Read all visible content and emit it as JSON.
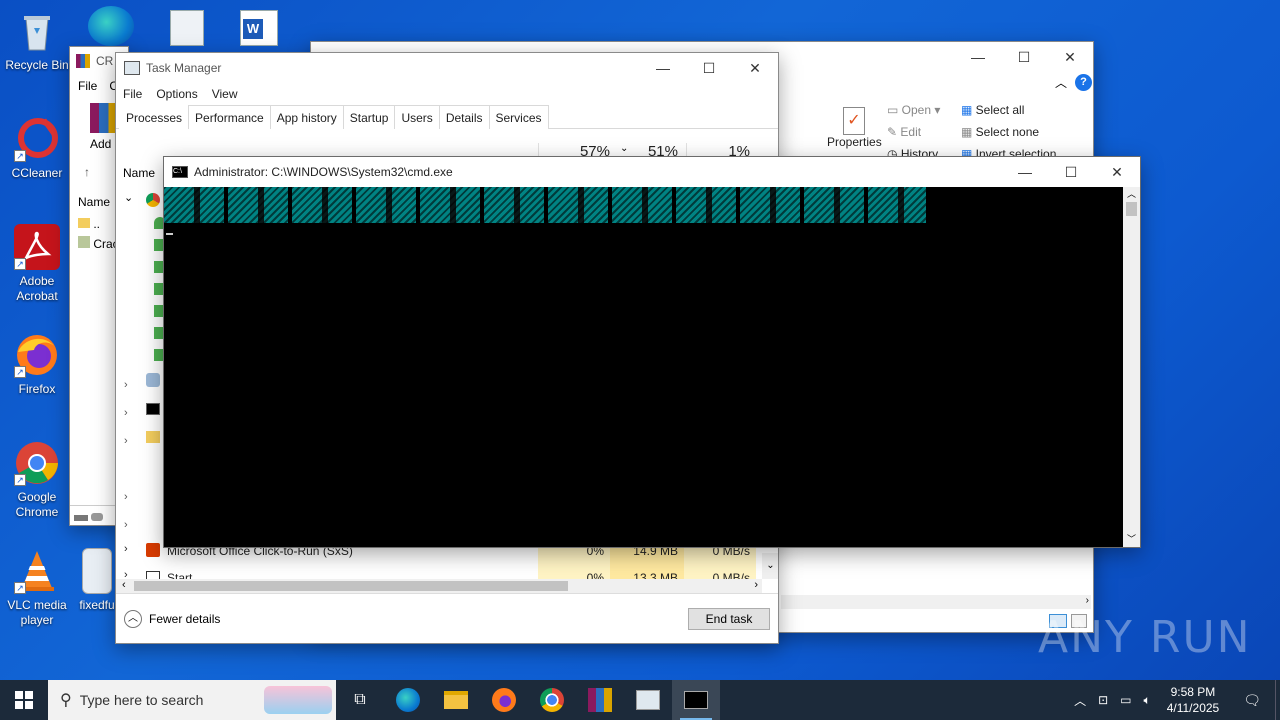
{
  "desktop": {
    "icons": [
      {
        "label": "Recycle Bin"
      },
      {
        "label": "CCleaner"
      },
      {
        "label": "Adobe Acrobat"
      },
      {
        "label": "Firefox"
      },
      {
        "label": "Google Chrome"
      },
      {
        "label": "VLC media player"
      },
      {
        "label": "fixedfu"
      }
    ]
  },
  "explorer": {
    "ribbon": {
      "properties": "Properties",
      "open": "Open",
      "edit": "Edit",
      "history": "History",
      "select_all": "Select all",
      "select_none": "Select none",
      "invert_selection": "Invert selection"
    }
  },
  "winrar": {
    "title": "CR",
    "menu_file": "File",
    "menu_c": "C",
    "add": "Add",
    "col_name": "Name",
    "row1": "..",
    "row2": "Crac"
  },
  "taskmgr": {
    "title": "Task Manager",
    "menu": [
      "File",
      "Options",
      "View"
    ],
    "tabs": [
      "Processes",
      "Performance",
      "App history",
      "Startup",
      "Users",
      "Details",
      "Services"
    ],
    "col_name": "Name",
    "cpu_pct": "57%",
    "mem_pct": "51%",
    "disk_pct": "1%",
    "rows": [
      {
        "name": "Microsoft Office Click-to-Run (SxS)",
        "cpu": "0%",
        "mem": "14.9 MB",
        "disk": "0 MB/s"
      },
      {
        "name": "Start",
        "cpu": "0%",
        "mem": "13.3 MB",
        "disk": "0 MB/s"
      }
    ],
    "fewer_details": "Fewer details",
    "end_task": "End task"
  },
  "cmd": {
    "title": "Administrator: C:\\WINDOWS\\System32\\cmd.exe"
  },
  "taskbar": {
    "search_placeholder": "Type here to search",
    "time": "9:58 PM",
    "date": "4/11/2025"
  },
  "watermark": "ANY RUN"
}
